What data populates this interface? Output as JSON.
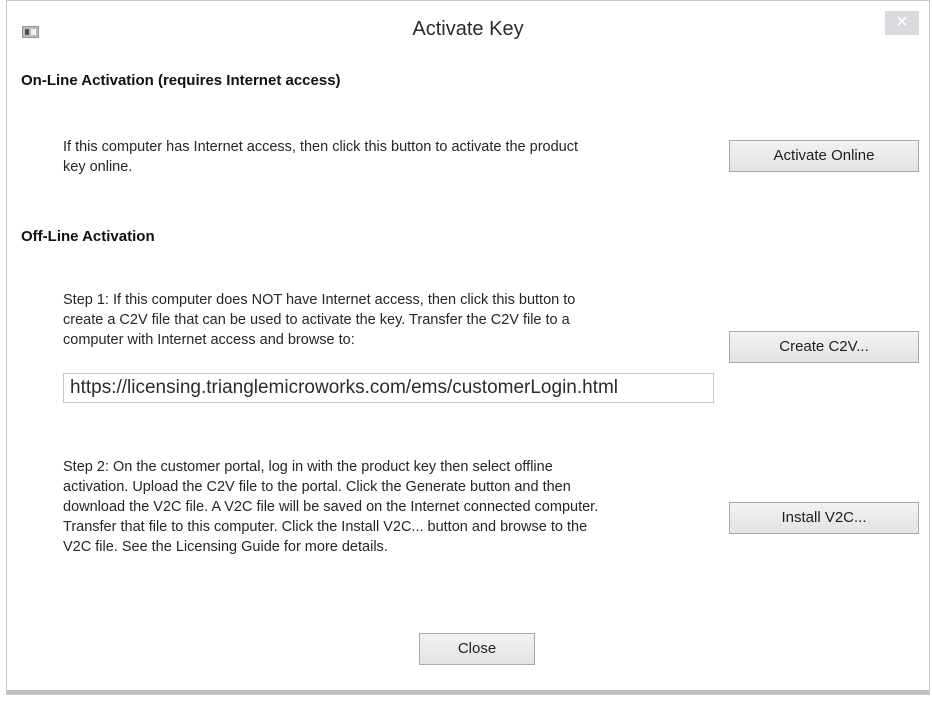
{
  "window": {
    "title": "Activate Key",
    "close_glyph": "✕"
  },
  "online": {
    "heading": "On-Line Activation (requires Internet access)",
    "line1": "If this computer has Internet access, then click this button to activate the  product",
    "line2": "key online.",
    "button_label": "Activate Online"
  },
  "offline": {
    "heading": "Off-Line Activation",
    "step1": {
      "line1": "Step 1:  If this computer does NOT have Internet access, then click this button to",
      "line2": "create a C2V file that can be used to activate the key.  Transfer the C2V file to a",
      "line3": "computer with Internet access and browse to:",
      "button_label": "Create C2V..."
    },
    "url": "https://licensing.trianglemicroworks.com/ems/customerLogin.html",
    "step2": {
      "line1": "Step 2: On the customer portal, log in with the product key then select offline",
      "line2": "activation.  Upload the C2V file to the portal.  Click the Generate button and then",
      "line3": "download the V2C file.  A V2C file will be saved on the Internet connected computer.",
      "line4": "Transfer that file to this computer.  Click the Install V2C... button and browse to the",
      "line5": "V2C file.     See the Licensing Guide for more details.",
      "button_label": "Install V2C..."
    }
  },
  "footer": {
    "close_label": "Close"
  },
  "icons": {
    "app": "app-window-icon",
    "close": "close-icon"
  }
}
